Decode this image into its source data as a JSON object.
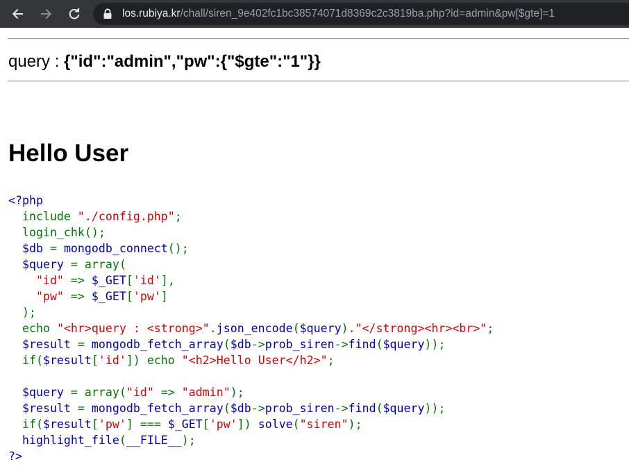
{
  "browser": {
    "url_host": "los.rubiya.kr",
    "url_rest": "/chall/siren_9e402fc1bc38574071d8369c2c3819ba.php?id=admin&pw[$gte]=1",
    "icons": [
      "back-arrow-icon",
      "forward-arrow-icon",
      "reload-icon",
      "lock-icon"
    ]
  },
  "page": {
    "query_prefix": "query : ",
    "query_json": "{\"id\":\"admin\",\"pw\":{\"$gte\":\"1\"}}",
    "heading": "Hello User"
  },
  "colors": {
    "default": "#0000BB",
    "keyword": "#007700",
    "string": "#DD0000",
    "chrome": "#35363a",
    "omnibox": "#202124"
  },
  "source_lines": [
    [
      [
        "d",
        "<?php"
      ]
    ],
    [
      [
        "k",
        "  include "
      ],
      [
        "s",
        "\"./config.php\""
      ],
      [
        "k",
        ";"
      ]
    ],
    [
      [
        "k",
        "  login_chk"
      ],
      [
        "k",
        "();"
      ]
    ],
    [
      [
        "d",
        "  $db"
      ],
      [
        "k",
        " = "
      ],
      [
        "d",
        "mongodb_connect"
      ],
      [
        "k",
        "();"
      ]
    ],
    [
      [
        "d",
        "  $query"
      ],
      [
        "k",
        " = array("
      ]
    ],
    [
      [
        "s",
        "    \"id\""
      ],
      [
        "k",
        " => "
      ],
      [
        "d",
        "$_GET"
      ],
      [
        "k",
        "["
      ],
      [
        "s",
        "'id'"
      ],
      [
        "k",
        "],"
      ]
    ],
    [
      [
        "s",
        "    \"pw\""
      ],
      [
        "k",
        " => "
      ],
      [
        "d",
        "$_GET"
      ],
      [
        "k",
        "["
      ],
      [
        "s",
        "'pw'"
      ],
      [
        "k",
        "]"
      ]
    ],
    [
      [
        "k",
        "  );"
      ]
    ],
    [
      [
        "k",
        "  echo "
      ],
      [
        "s",
        "\"<hr>query : <strong>\""
      ],
      [
        "k",
        "."
      ],
      [
        "d",
        "json_encode"
      ],
      [
        "k",
        "("
      ],
      [
        "d",
        "$query"
      ],
      [
        "k",
        ")."
      ],
      [
        "s",
        "\"</strong><hr><br>\""
      ],
      [
        "k",
        ";"
      ]
    ],
    [
      [
        "d",
        "  $result"
      ],
      [
        "k",
        " = "
      ],
      [
        "d",
        "mongodb_fetch_array"
      ],
      [
        "k",
        "("
      ],
      [
        "d",
        "$db"
      ],
      [
        "k",
        "->"
      ],
      [
        "d",
        "prob_siren"
      ],
      [
        "k",
        "->"
      ],
      [
        "d",
        "find"
      ],
      [
        "k",
        "("
      ],
      [
        "d",
        "$query"
      ],
      [
        "k",
        "));"
      ]
    ],
    [
      [
        "k",
        "  if("
      ],
      [
        "d",
        "$result"
      ],
      [
        "k",
        "["
      ],
      [
        "s",
        "'id'"
      ],
      [
        "k",
        "]) echo "
      ],
      [
        "s",
        "\"<h2>Hello User</h2>\""
      ],
      [
        "k",
        ";"
      ]
    ],
    [
      [
        "d",
        ""
      ]
    ],
    [
      [
        "d",
        "  $query"
      ],
      [
        "k",
        " = array("
      ],
      [
        "s",
        "\"id\""
      ],
      [
        "k",
        " => "
      ],
      [
        "s",
        "\"admin\""
      ],
      [
        "k",
        ");"
      ]
    ],
    [
      [
        "d",
        "  $result"
      ],
      [
        "k",
        " = "
      ],
      [
        "d",
        "mongodb_fetch_array"
      ],
      [
        "k",
        "("
      ],
      [
        "d",
        "$db"
      ],
      [
        "k",
        "->"
      ],
      [
        "d",
        "prob_siren"
      ],
      [
        "k",
        "->"
      ],
      [
        "d",
        "find"
      ],
      [
        "k",
        "("
      ],
      [
        "d",
        "$query"
      ],
      [
        "k",
        "));"
      ]
    ],
    [
      [
        "k",
        "  if("
      ],
      [
        "d",
        "$result"
      ],
      [
        "k",
        "["
      ],
      [
        "s",
        "'pw'"
      ],
      [
        "k",
        "] === "
      ],
      [
        "d",
        "$_GET"
      ],
      [
        "k",
        "["
      ],
      [
        "s",
        "'pw'"
      ],
      [
        "k",
        "]) "
      ],
      [
        "d",
        "solve"
      ],
      [
        "k",
        "("
      ],
      [
        "s",
        "\"siren\""
      ],
      [
        "k",
        ");"
      ]
    ],
    [
      [
        "k",
        "  "
      ],
      [
        "d",
        "highlight_file"
      ],
      [
        "k",
        "("
      ],
      [
        "d",
        "__FILE__"
      ],
      [
        "k",
        ");"
      ]
    ],
    [
      [
        "d",
        "?>"
      ]
    ]
  ]
}
